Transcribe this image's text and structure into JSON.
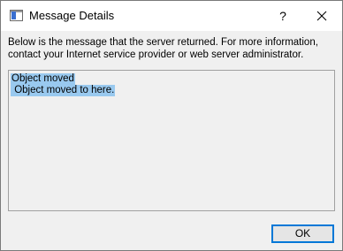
{
  "window": {
    "title": "Message Details",
    "help_label": "?",
    "close_icon": "close-icon",
    "app_icon": "window-icon"
  },
  "content": {
    "message_line1": "Below is the message that the server returned. For more information,",
    "message_line2": "contact your Internet service provider or web server administrator.",
    "response_lines": [
      "Object moved",
      " Object moved to here."
    ]
  },
  "buttons": {
    "ok_label": "OK"
  },
  "colors": {
    "selection": "#99c9ef",
    "focus_border": "#0078d7",
    "dialog_bg": "#f0f0f0"
  }
}
